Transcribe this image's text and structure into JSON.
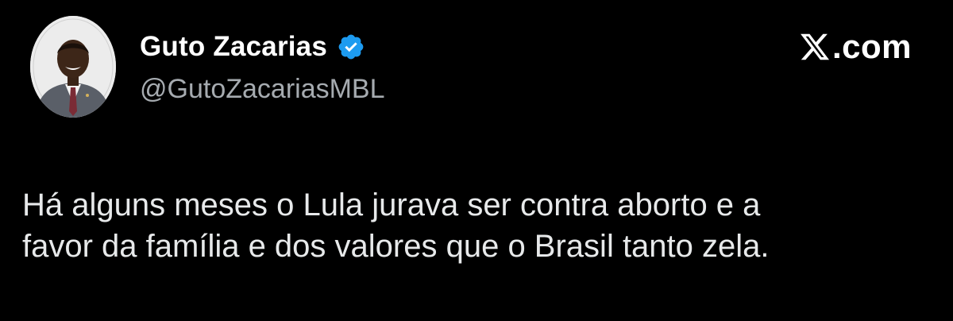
{
  "author": {
    "display_name": "Guto Zacarias",
    "handle": "@GutoZacariasMBL",
    "verified": true,
    "avatar_icon": "profile-photo",
    "verified_icon": "verified-badge-icon"
  },
  "brand": {
    "icon": "x-logo-icon",
    "label": ".com"
  },
  "tweet": {
    "lines": [
      "Há alguns meses o Lula jurava ser contra aborto e a",
      "favor da família e dos valores que o Brasil tanto zela."
    ]
  },
  "colors": {
    "background": "#000000",
    "name": "#ffffff",
    "handle": "#a6abb0",
    "text": "#e7e9ea",
    "verified": "#1d9bf0"
  }
}
